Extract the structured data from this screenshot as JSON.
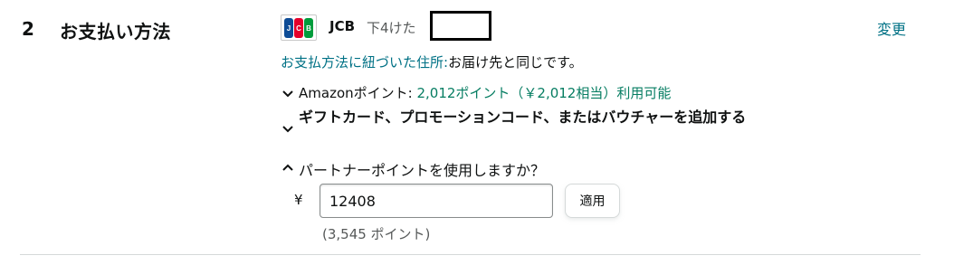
{
  "section": {
    "number": "2",
    "title": "お支払い方法"
  },
  "payment": {
    "card_brand": "JCB",
    "last4_label": "下4けた",
    "change_link": "変更",
    "address_label": "お支払方法に紐づいた住所:",
    "address_value": "お届け先と同じです。"
  },
  "amazon_points": {
    "label": "Amazonポイント:",
    "value": "2,012ポイント（￥2,012相当）利用可能"
  },
  "gift": {
    "label": "ギフトカード、プロモーションコード、またはバウチャーを追加する"
  },
  "partner_points": {
    "question": "パートナーポイントを使用しますか？",
    "currency": "¥",
    "input_value": "12408",
    "apply_label": "適用",
    "points_note": "(3,545 ポイント)"
  },
  "colors": {
    "link": "#007185",
    "points_green": "#067d62",
    "text": "#0f1111",
    "muted": "#565959"
  },
  "icons": [
    "jcb-card-logo",
    "chevron-down-icon",
    "chevron-up-icon"
  ]
}
